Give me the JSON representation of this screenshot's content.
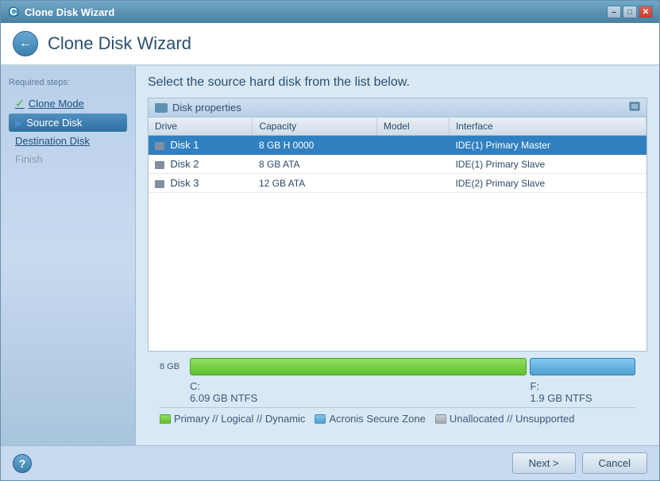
{
  "window": {
    "title": "Clone Disk Wizard",
    "controls": {
      "minimize": "–",
      "restore": "□",
      "close": "✕"
    }
  },
  "header": {
    "title": "Clone Disk Wizard"
  },
  "sidebar": {
    "required_label": "Required steps:",
    "items": [
      {
        "id": "clone-mode",
        "label": "Clone Mode",
        "state": "checked"
      },
      {
        "id": "source-disk",
        "label": "Source Disk",
        "state": "active"
      },
      {
        "id": "destination-disk",
        "label": "Destination Disk",
        "state": "link"
      },
      {
        "id": "finish",
        "label": "Finish",
        "state": "dimmed"
      }
    ]
  },
  "main": {
    "title": "Select the source hard disk from the list below.",
    "disk_properties_label": "Disk properties",
    "table": {
      "columns": [
        "Drive",
        "Capacity",
        "Model",
        "Interface"
      ],
      "rows": [
        {
          "id": "disk1",
          "drive": "Disk 1",
          "capacity": "8 GB H 0000",
          "model": "",
          "interface": "IDE(1) Primary Master",
          "selected": true
        },
        {
          "id": "disk2",
          "drive": "Disk 2",
          "capacity": "8 GB ATA",
          "model": "",
          "interface": "IDE(1) Primary Slave",
          "selected": false
        },
        {
          "id": "disk3",
          "drive": "Disk 3",
          "capacity": "12 GB ATA",
          "model": "",
          "interface": "IDE(2) Primary Slave",
          "selected": false
        }
      ]
    }
  },
  "disk_visual": {
    "size_label": "8 GB",
    "partitions": [
      {
        "id": "c",
        "label": "C:",
        "size": "6.09 GB NTFS",
        "type": "primary"
      },
      {
        "id": "f",
        "label": "F:",
        "size": "1.9 GB NTFS",
        "type": "primary"
      }
    ]
  },
  "legend": {
    "items": [
      {
        "id": "primary",
        "color": "green",
        "label": "Primary // Logical // Dynamic"
      },
      {
        "id": "acronis",
        "color": "blue",
        "label": "Acronis Secure Zone"
      },
      {
        "id": "unallocated",
        "color": "gray",
        "label": "Unallocated // Unsupported"
      }
    ]
  },
  "footer": {
    "next_label": "Next >",
    "cancel_label": "Cancel"
  }
}
